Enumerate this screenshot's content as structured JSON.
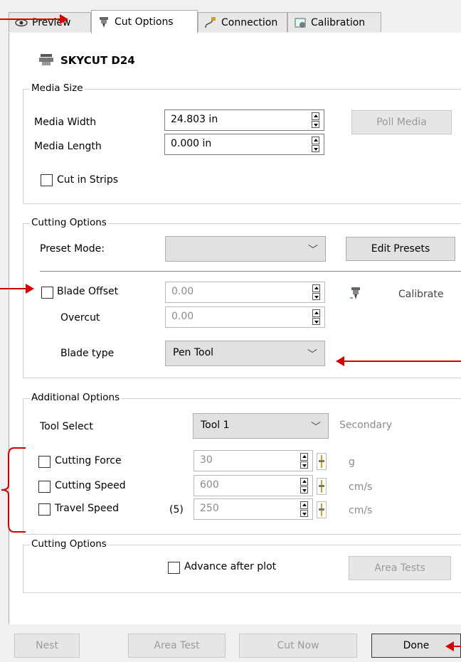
{
  "tabs": [
    {
      "label": "Preview",
      "icon": "eye-icon"
    },
    {
      "label": "Cut Options",
      "icon": "cutter-icon"
    },
    {
      "label": "Connection",
      "icon": "cable-icon"
    },
    {
      "label": "Calibration",
      "icon": "calibration-icon"
    }
  ],
  "device": {
    "name": "SKYCUT D24",
    "icon": "plotter-icon"
  },
  "media_size": {
    "title": "Media Size",
    "width_label": "Media Width",
    "width_value": "24.803 in",
    "length_label": "Media Length",
    "length_value": "0.000 in",
    "poll_media": "Poll Media",
    "cut_in_strips": "Cut in Strips"
  },
  "cutting_options": {
    "title": "Cutting Options",
    "preset_label": "Preset Mode:",
    "preset_value": "",
    "edit_presets": "Edit Presets",
    "blade_offset_label": "Blade Offset",
    "blade_offset_value": "0.00",
    "overcut_label": "Overcut",
    "overcut_value": "0.00",
    "calibrate": "Calibrate",
    "blade_type_label": "Blade type",
    "blade_type_value": "Pen Tool"
  },
  "additional_options": {
    "title": "Additional Options",
    "tool_select_label": "Tool Select",
    "tool_select_value": "Tool 1",
    "secondary": "Secondary",
    "rows": [
      {
        "label": "Cutting Force",
        "value": "30",
        "unit": "g",
        "prefix": ""
      },
      {
        "label": "Cutting Speed",
        "value": "600",
        "unit": "cm/s",
        "prefix": ""
      },
      {
        "label": "Travel Speed",
        "value": "250",
        "unit": "cm/s",
        "prefix": "(5)"
      }
    ]
  },
  "cutting_options_2": {
    "title": "Cutting Options",
    "advance_after_plot": "Advance after plot",
    "area_tests": "Area Tests"
  },
  "footer": {
    "nest": "Nest",
    "area_test": "Area Test",
    "cut_now": "Cut Now",
    "done": "Done"
  },
  "annotation_color": "#d40000"
}
